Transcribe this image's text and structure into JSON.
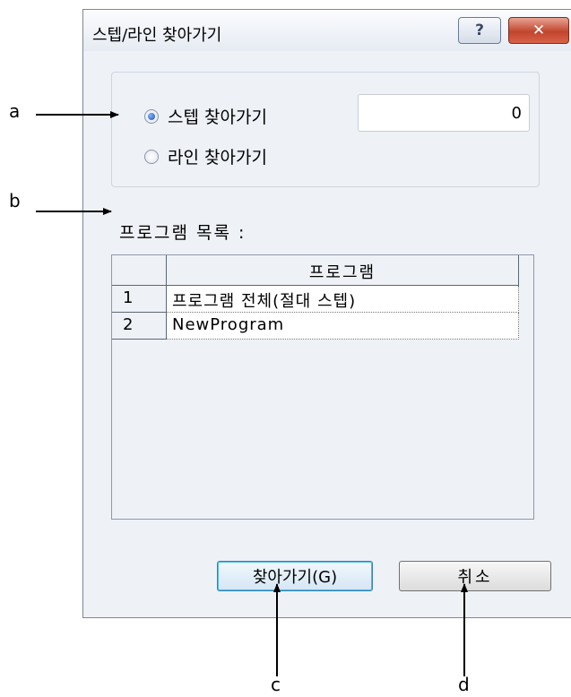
{
  "dialog": {
    "title": "스텝/라인 찾아가기",
    "help_button": "?",
    "close_button": "✕",
    "options": {
      "step_label": "스텝 찾아가기",
      "line_label": "라인 찾아가기",
      "selected": "step",
      "step_value": "0"
    },
    "program_list_label": "프로그램 목록 :",
    "table": {
      "columns": [
        "",
        "프로그램"
      ],
      "rows": [
        {
          "num": "1",
          "name": "프로그램 전체(절대 스텝)"
        },
        {
          "num": "2",
          "name": "NewProgram"
        }
      ]
    },
    "buttons": {
      "go": "찾아가기(G)",
      "cancel": "취소"
    }
  },
  "callouts": {
    "a": "a",
    "b": "b",
    "c": "c",
    "d": "d"
  }
}
